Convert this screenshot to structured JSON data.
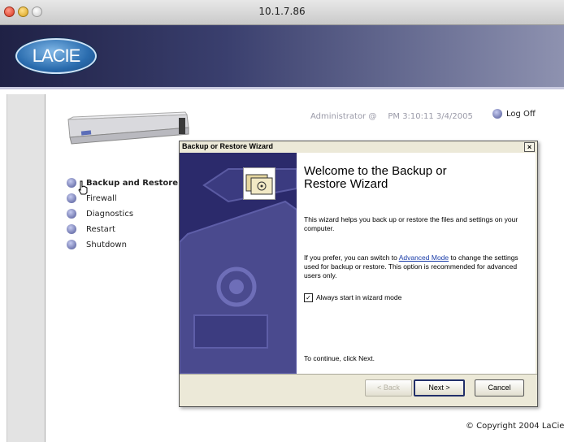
{
  "window": {
    "title": "10.1.7.86"
  },
  "brand": {
    "logo_text": "LACIE"
  },
  "status": {
    "user": "Administrator  @",
    "time": "PM 3:10:11  3/4/2005",
    "logoff": "Log Off"
  },
  "menu": [
    {
      "label": "Backup and Restore",
      "active": true
    },
    {
      "label": "Firewall"
    },
    {
      "label": "Diagnostics"
    },
    {
      "label": "Restart"
    },
    {
      "label": "Shutdown"
    }
  ],
  "dialog": {
    "title": "Backup or Restore Wizard",
    "close": "×",
    "heading": "Welcome to the Backup or Restore Wizard",
    "para1": "This wizard helps you back up or restore the files and settings on your computer.",
    "para2_before": "If you prefer, you can switch to ",
    "para2_link": "Advanced Mode",
    "para2_after": " to change the settings used for backup or restore. This option is recommended for advanced users only.",
    "checkbox_label": "Always start in wizard mode",
    "checkbox_checked": true,
    "continue_text": "To continue, click Next.",
    "buttons": {
      "back": "< Back",
      "next": "Next >",
      "cancel": "Cancel"
    }
  },
  "footer": {
    "copyright": "© Copyright 2004 LaCie"
  },
  "colors": {
    "banner": "#2c2f5a",
    "menu_dot": "#4d5595",
    "wizard_side": "#2b2a6b",
    "link": "#1a3ca8"
  }
}
